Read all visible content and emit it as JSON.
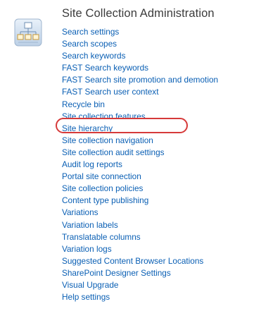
{
  "section": {
    "title": "Site Collection Administration",
    "icon": "site-hierarchy-icon",
    "links": [
      "Search settings",
      "Search scopes",
      "Search keywords",
      "FAST Search keywords",
      "FAST Search site promotion and demotion",
      "FAST Search user context",
      "Recycle bin",
      "Site collection features",
      "Site hierarchy",
      "Site collection navigation",
      "Site collection audit settings",
      "Audit log reports",
      "Portal site connection",
      "Site collection policies",
      "Content type publishing",
      "Variations",
      "Variation labels",
      "Translatable columns",
      "Variation logs",
      "Suggested Content Browser Locations",
      "SharePoint Designer Settings",
      "Visual Upgrade",
      "Help settings"
    ]
  },
  "colors": {
    "link": "#0a5fb4",
    "title": "#3b3b3b",
    "highlight": "#d63a3a"
  }
}
